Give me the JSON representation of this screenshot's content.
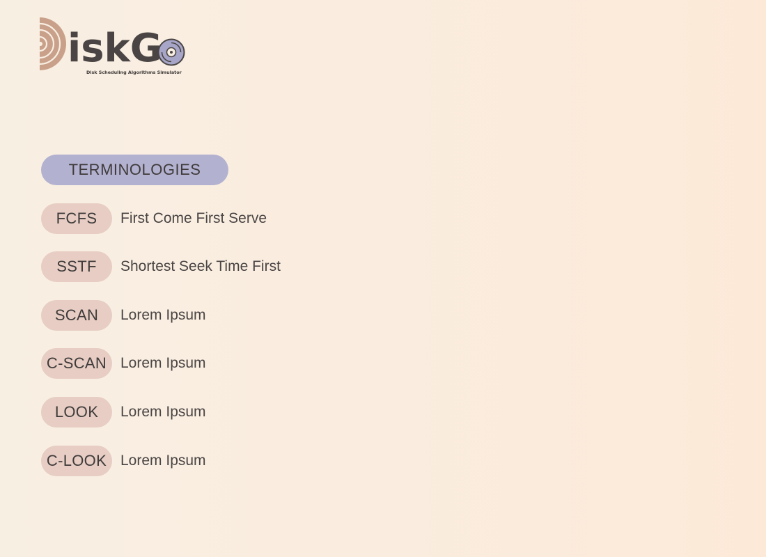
{
  "logo": {
    "wordmark": "iskG",
    "subtitle": "Disk Scheduling Algorithms Simulator",
    "colors": {
      "d_letter": "#c9a089",
      "disc": "#a8a6c8",
      "text": "#4a4544"
    }
  },
  "terminologies": {
    "heading": "TERMINOLOGIES",
    "items": [
      {
        "abbr": "FCFS",
        "definition": "First Come First Serve"
      },
      {
        "abbr": "SSTF",
        "definition": "Shortest Seek Time First"
      },
      {
        "abbr": "SCAN",
        "definition": "Lorem Ipsum"
      },
      {
        "abbr": "C-SCAN",
        "definition": "Lorem Ipsum"
      },
      {
        "abbr": "LOOK",
        "definition": "Lorem Ipsum"
      },
      {
        "abbr": "C-LOOK",
        "definition": "Lorem Ipsum"
      }
    ]
  },
  "colors": {
    "heading_pill": "#b3b1d0",
    "term_pill": "#e7cdc3",
    "background_start": "#f8efe3",
    "background_end": "#fde9d8"
  }
}
